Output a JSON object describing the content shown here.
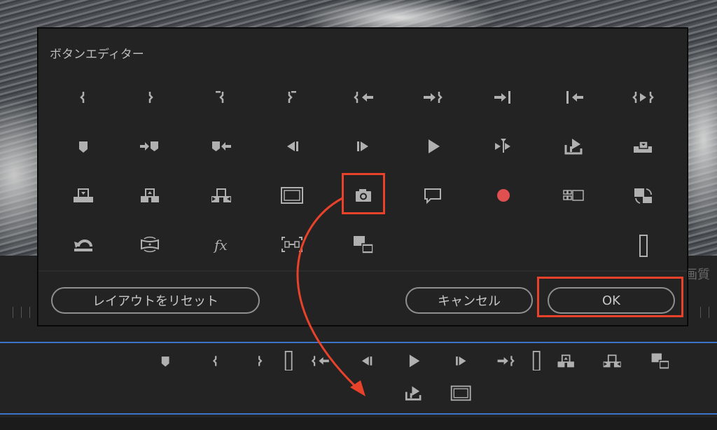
{
  "dialog": {
    "title": "ボタンエディター",
    "icons": [
      [
        "mark-in",
        "mark-out",
        "mark-clip-in",
        "mark-clip-out",
        "go-to-in",
        "go-to-out",
        "go-to-next-edit",
        "go-to-previous-edit",
        "play-in-to-out"
      ],
      [
        "add-marker",
        "go-to-next-marker",
        "go-to-previous-marker",
        "step-back",
        "step-forward",
        "play",
        "play-around",
        "export",
        "overwrite-insert"
      ],
      [
        "extract",
        "lift",
        "insert",
        "safe-margins",
        "export-frame",
        "comment",
        "record",
        "multi-camera",
        "toggle-proxies"
      ],
      [
        "loop-playback",
        "vr-video",
        "fx",
        "trim",
        "compare-view",
        "",
        "",
        "",
        "spacer"
      ]
    ],
    "reset_label": "レイアウトをリセット",
    "cancel_label": "キャンセル",
    "ok_label": "OK",
    "highlight_color": "#e8422a",
    "record_color": "#e05050"
  },
  "background": {
    "partial_label": "画質"
  },
  "toolbar": {
    "row1": [
      "add-marker",
      "mark-in",
      "mark-out",
      "spacer",
      "go-to-in",
      "step-back",
      "play",
      "step-forward",
      "go-to-out",
      "spacer",
      "lift",
      "insert",
      "compare-view"
    ],
    "row2": [
      "export",
      "safe-margins"
    ]
  }
}
